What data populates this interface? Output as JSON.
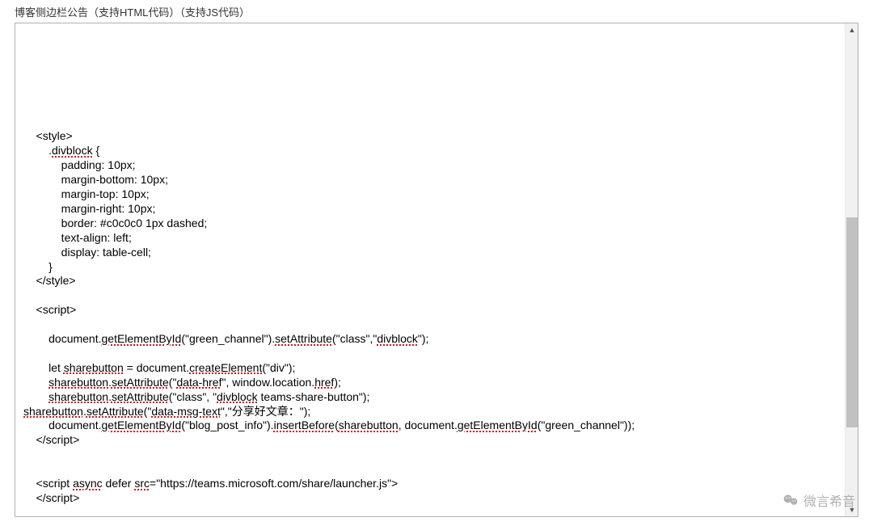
{
  "label": "博客侧边栏公告（支持HTML代码）（支持JS代码）",
  "code": {
    "blank1": "",
    "blank2": "",
    "blank3": "",
    "blank4": "",
    "blank5": "",
    "blank6": "",
    "blank7": "",
    "l1a": "    <style>",
    "l2a": "        .",
    "l2sc": "divblock",
    "l2b": " {",
    "l3": "            padding: 10px;",
    "l4": "            margin-bottom: 10px;",
    "l5": "            margin-top: 10px;",
    "l6": "            margin-right: 10px;",
    "l7": "            border: #c0c0c0 1px dashed;",
    "l8": "            text-align: left;",
    "l9": "            display: table-cell;",
    "l10": "        }",
    "l11": "    </style>",
    "blank8": "",
    "l12": "    <script>",
    "blank9": "",
    "l13a": "        document.",
    "l13sc1": "getElementById",
    "l13b": "(\"green_channel\").",
    "l13sc2": "setAttribute",
    "l13c": "(\"class\",\"",
    "l13sc3": "divblock",
    "l13d": "\");",
    "blank10": "",
    "l14a": "        let ",
    "l14sc1": "sharebutton",
    "l14b": " = document.",
    "l14sc2": "createElement",
    "l14c": "(\"div\");",
    "l15a": "        ",
    "l15sc1": "sharebutton",
    "l15b": ".",
    "l15sc2": "setAttribute",
    "l15c": "(\"",
    "l15sc3": "data-href",
    "l15d": "\", window.location.",
    "l15sc4": "href",
    "l15e": ");",
    "l16a": "        ",
    "l16sc1": "sharebutton",
    "l16b": ".",
    "l16sc2": "setAttribute",
    "l16c": "(\"class\", \"",
    "l16sc3": "divblock",
    "l16d": " teams-share-button\");",
    "l17a": "",
    "l17sc1": "sharebutton",
    "l17b": ".",
    "l17sc2": "setAttribute",
    "l17c": "(\"",
    "l17sc3": "data-msg-text",
    "l17d": "\",\"分享好文章：\");",
    "l18a": "        document.",
    "l18sc1": "getElementById",
    "l18b": "(\"blog_post_info\").",
    "l18sc2": "insertBefore",
    "l18c": "(",
    "l18sc3": "sharebutton",
    "l18d": ", document.",
    "l18sc4": "getElementById",
    "l18e": "(\"green_channel\"));",
    "l19": "    </script>",
    "blank11": "",
    "blank12": "",
    "l20a": "    <script ",
    "l20sc1": "async",
    "l20b": " defer ",
    "l20sc2": "src",
    "l20c": "=\"https://teams.microsoft.com/share/launcher.js\">",
    "l21": "    </script>"
  },
  "watermark": "微言希音"
}
